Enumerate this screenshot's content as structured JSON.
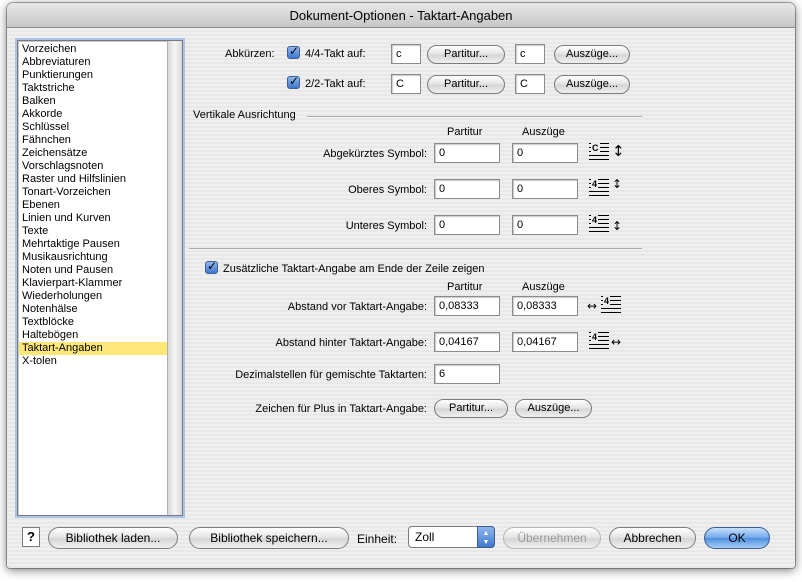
{
  "window": {
    "title": "Dokument-Optionen - Taktart-Angaben"
  },
  "sidebar": {
    "items": [
      "Vorzeichen",
      "Abbreviaturen",
      "Punktierungen",
      "Taktstriche",
      "Balken",
      "Akkorde",
      "Schlüssel",
      "Fähnchen",
      "Zeichensätze",
      "Vorschlagsnoten",
      "Raster und Hilfslinien",
      "Tonart-Vorzeichen",
      "Ebenen",
      "Linien und Kurven",
      "Texte",
      "Mehrtaktige Pausen",
      "Musikausrichtung",
      "Noten und Pausen",
      "Klavierpart-Klammer",
      "Wiederholungen",
      "Notenhälse",
      "Textblöcke",
      "Haltebögen",
      "Taktart-Angaben",
      "X-tolen"
    ],
    "selected_index": 23
  },
  "abbrev": {
    "label": "Abkürzen:",
    "row1": {
      "label": "4/4-Takt auf:",
      "score_value": "c",
      "score_button": "Partitur...",
      "parts_value": "c",
      "parts_button": "Auszüge..."
    },
    "row2": {
      "label": "2/2-Takt auf:",
      "score_value": "C",
      "score_button": "Partitur...",
      "parts_value": "C",
      "parts_button": "Auszüge..."
    }
  },
  "vertical": {
    "title": "Vertikale Ausrichtung",
    "col_score": "Partitur",
    "col_parts": "Auszüge",
    "rows": [
      {
        "label": "Abgekürztes Symbol:",
        "score": "0",
        "parts": "0"
      },
      {
        "label": "Oberes Symbol:",
        "score": "0",
        "parts": "0"
      },
      {
        "label": "Unteres Symbol:",
        "score": "0",
        "parts": "0"
      }
    ]
  },
  "extra": {
    "checkbox_label": "Zusätzliche Taktart-Angabe am Ende der Zeile zeigen",
    "col_score": "Partitur",
    "col_parts": "Auszüge",
    "rows": [
      {
        "label": "Abstand vor Taktart-Angabe:",
        "score": "0,08333",
        "parts": "0,08333"
      },
      {
        "label": "Abstand hinter Taktart-Angabe:",
        "score": "0,04167",
        "parts": "0,04167"
      }
    ],
    "decimals_label": "Dezimalstellen für gemischte Taktarten:",
    "decimals_value": "6",
    "plus_label": "Zeichen für Plus in Taktart-Angabe:",
    "plus_score_button": "Partitur...",
    "plus_parts_button": "Auszüge..."
  },
  "footer": {
    "help": "?",
    "load_library": "Bibliothek laden...",
    "save_library": "Bibliothek speichern...",
    "unit_label": "Einheit:",
    "unit_value": "Zoll",
    "apply": "Übernehmen",
    "cancel": "Abbrechen",
    "ok": "OK"
  },
  "colors": {
    "selection": "#fde779",
    "accent": "#4f8ee0"
  },
  "icons": {
    "arrow_updown": "↕",
    "arrow_leftright": "↔"
  }
}
